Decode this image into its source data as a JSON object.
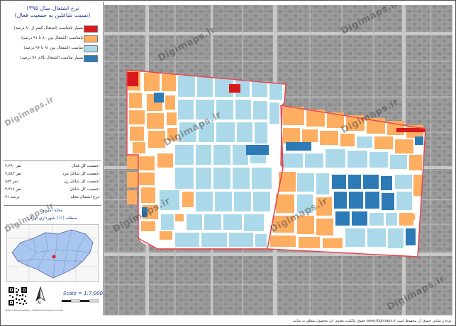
{
  "panel": {
    "title_line1": "نرخ اشتغال سال ۱۳۹۵",
    "title_line2": "(نسبت شاغلین به جمعیت فعال)",
    "legend": [
      {
        "label": "بسیار نامناسب (اشتغال کمتر از ۸۰ درصد)",
        "color": "#d7191c"
      },
      {
        "label": "نامناسب (اشتغال بین ۸۰ تا ۹۱ درصد)",
        "color": "#fdae61"
      },
      {
        "label": "مناسب (اشتغال بین ۹۱ تا ۹۶ درصد)",
        "color": "#abd9e9"
      },
      {
        "label": "بسیار مناسب (اشتغال بالای ۹۶ درصد)",
        "color": "#2c7bb6"
      }
    ],
    "stats": [
      {
        "label": "جمعیت کل فعال:",
        "value": "۴,۳۹۰ نفر"
      },
      {
        "label": "جمعیت کل شاغل مرد:",
        "value": "۳,۵۸۳ نفر"
      },
      {
        "label": "جمعیت کل شاغل زن:",
        "value": "۸۸۴ نفر"
      },
      {
        "label": "جمعیت کل شاغل:",
        "value": "۴,۴۶۷ نفر"
      },
      {
        "label": "نرخ اشتغال محله:",
        "value": "۹۱ درصد"
      }
    ],
    "location_line1": "محله امیریه",
    "location_line2": "منطقه (۱۱) شهرداری تهران",
    "scale": "Scale = 1:7,000",
    "north": "N",
    "source_note": "Tehran Municipality | Statistical Center of Iran"
  },
  "watermark": "Digimaps.ir",
  "footer": "حقوق مالکیت معنوی این محصول متعلق به سایت www.digimaps.ir بوده و تمامی حقوق آن محفوظ است.",
  "colors": {
    "very_poor": "#d7191c",
    "poor": "#fdae61",
    "good": "#abd9e9",
    "very_good": "#2c7bb6",
    "boundary": "#e8474f",
    "basemap": "#9b9b9b"
  }
}
